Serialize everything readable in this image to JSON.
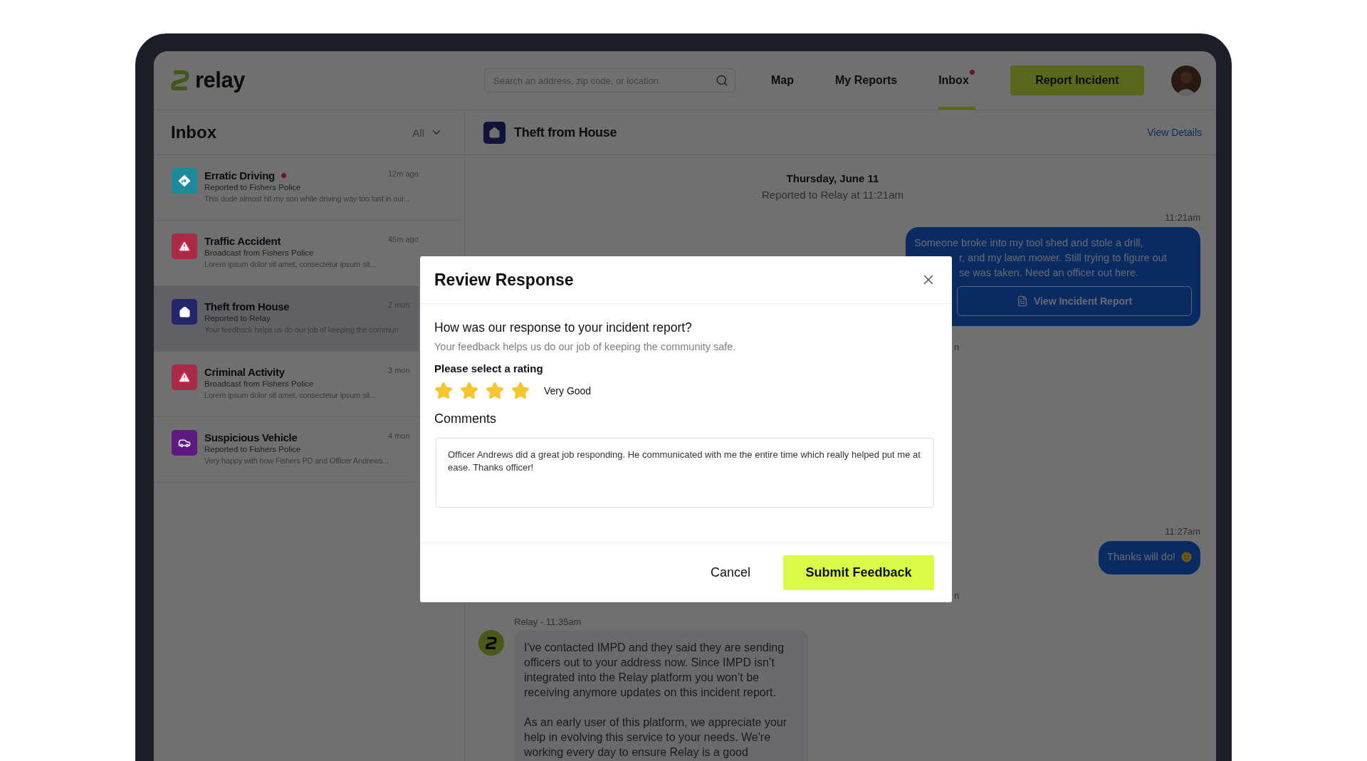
{
  "app": {
    "logo": "relay",
    "search": {
      "placeholder": "Search an address, zip code, or location"
    },
    "nav": [
      {
        "label": "Map",
        "selected": false,
        "notification": false
      },
      {
        "label": "My Reports",
        "selected": false,
        "notification": false
      },
      {
        "label": "Inbox",
        "selected": true,
        "notification": true
      }
    ],
    "cta": "Report Incident"
  },
  "inbox": {
    "title": "Inbox",
    "filter": "All",
    "items": [
      {
        "kind": "direction",
        "color": "#1d8a9a",
        "title": "Erratic Driving",
        "unread": true,
        "subtitle": "Reported to Fishers Police",
        "preview": "This dude almost hit my son while driving way too fast in our...",
        "time": "12m ago",
        "selected": false
      },
      {
        "kind": "warning",
        "color": "#a82a45",
        "title": "Traffic Accident",
        "unread": false,
        "subtitle": "Broadcast from Fishers Police",
        "preview": "Lorem ipsum dolor sit amet, consectetur ipsum sit...",
        "time": "45m ago",
        "selected": false
      },
      {
        "kind": "home",
        "color": "#24266a",
        "title": "Theft from House",
        "unread": false,
        "subtitle": "Reported to Relay",
        "preview": "Your feedback helps us do our job of keeping the commun",
        "time": "2 mon",
        "selected": true
      },
      {
        "kind": "warning",
        "color": "#a82a45",
        "title": "Criminal Activity",
        "unread": false,
        "subtitle": "Broadcast from Fishers Police",
        "preview": "Lorem ipsum dolor sit amet, consectetur ipsum sit...",
        "time": "3 mon",
        "selected": false
      },
      {
        "kind": "car",
        "color": "#5e1a80",
        "title": "Suspicious Vehicle",
        "unread": false,
        "subtitle": "Reported to Fishers Police",
        "preview": "Very happy with how Fishers PD and Officer Andrews...",
        "time": "4 mon",
        "selected": false
      }
    ]
  },
  "conversation": {
    "title": "Theft from House",
    "details_link": "View Details",
    "date": "Thursday, June 11",
    "reported": "Reported to Relay at 11:21am",
    "messages": [
      {
        "kind": "sent",
        "time": "11:21am",
        "lines": [
          "Someone broke into my tool shed and stole a drill,",
          "r, and my lawn mower. Still trying to figure out",
          "se was taken. Need an officer out here."
        ],
        "action": "View Incident Report"
      },
      {
        "kind": "fragment",
        "text": "n"
      },
      {
        "kind": "sent",
        "time": "11:27am",
        "lines": [
          "Thanks will do!"
        ],
        "emoji": true
      },
      {
        "kind": "fragment",
        "text": "n"
      },
      {
        "kind": "received",
        "author": "Relay - 11:35am",
        "paragraphs": [
          "I've contacted IMPD and they said they are sending officers out to your address now. Since IMPD isn’t integrated into the Relay platform you won’t be receiving anymore updates on this incident report.",
          "As an early user of this platform, we appreciate your help in evolving this service to your needs. We're working every day to ensure Relay is a good"
        ]
      }
    ]
  },
  "dialog": {
    "title": "Review Response",
    "question": "How was our response to your incident report?",
    "hint": "Your feedback helps us do our job of keeping the community safe.",
    "rating_label": "Please select a rating",
    "stars": 4,
    "rating_text": "Very Good",
    "comments_label": "Comments",
    "comment": "Officer Andrews did a great job responding. He communicated with me the entire time which really helped put me at ease. Thanks officer!",
    "cancel": "Cancel",
    "submit": "Submit Feedback"
  }
}
